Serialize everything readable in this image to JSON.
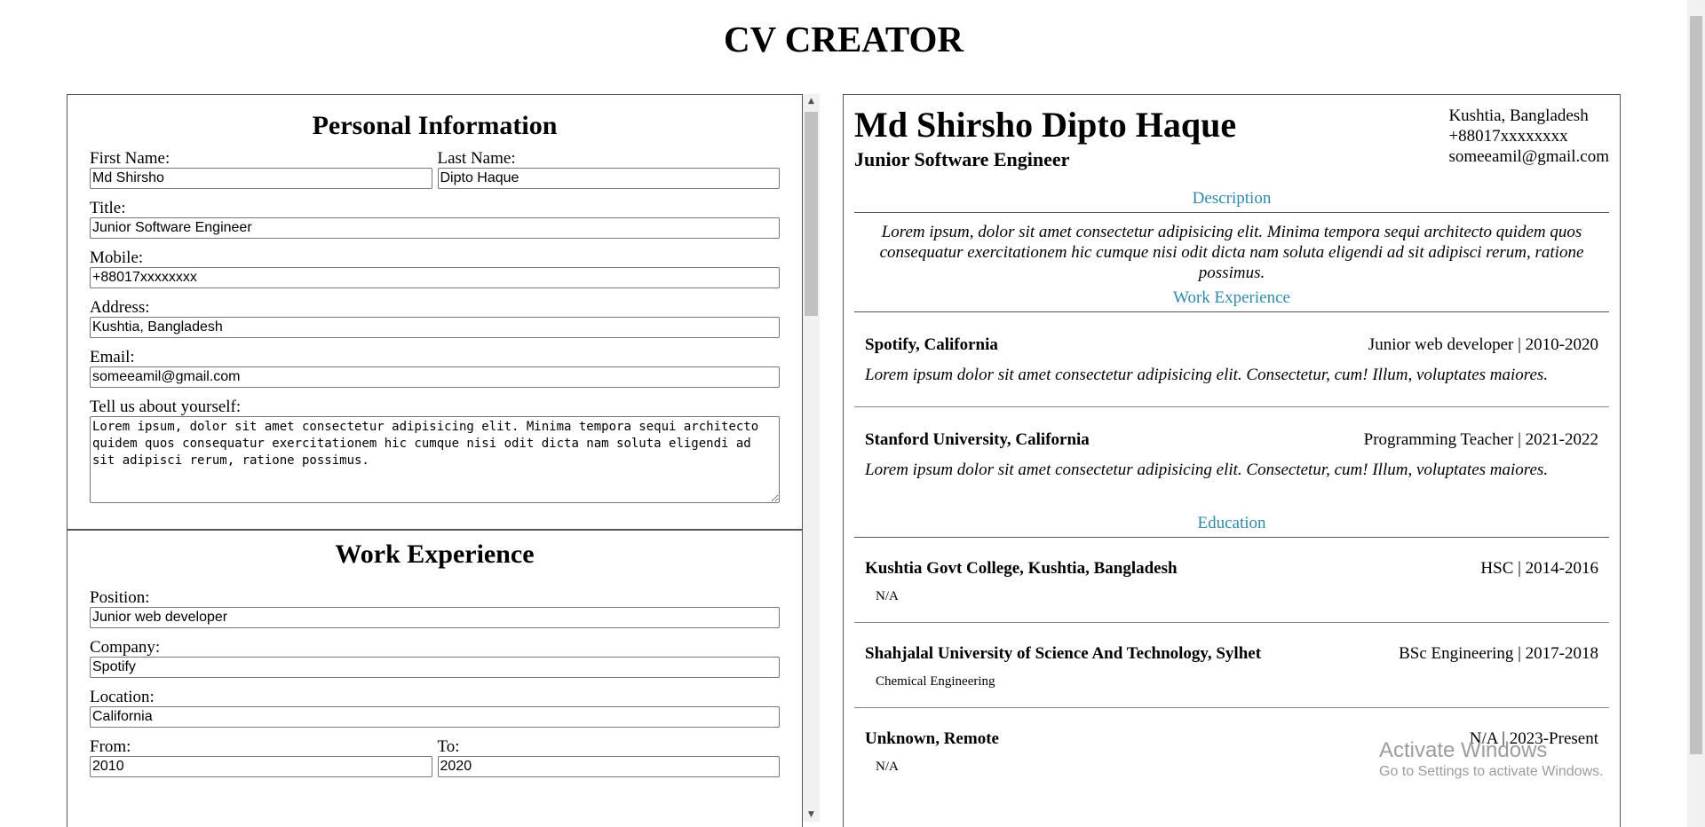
{
  "app": {
    "title": "CV CREATOR"
  },
  "form": {
    "personal": {
      "heading": "Personal Information",
      "first_name_label": "First Name:",
      "first_name_value": "Md Shirsho",
      "last_name_label": "Last Name:",
      "last_name_value": "Dipto Haque",
      "title_label": "Title:",
      "title_value": "Junior Software Engineer",
      "mobile_label": "Mobile:",
      "mobile_value": "+88017xxxxxxxx",
      "address_label": "Address:",
      "address_value": "Kushtia, Bangladesh",
      "email_label": "Email:",
      "email_value": "someeamil@gmail.com",
      "about_label": "Tell us about yourself:",
      "about_value": "Lorem ipsum, dolor sit amet consectetur adipisicing elit. Minima tempora sequi architecto quidem quos consequatur exercitationem hic cumque nisi odit dicta nam soluta eligendi ad sit adipisci rerum, ratione possimus."
    },
    "work": {
      "heading": "Work Experience",
      "position_label": "Position:",
      "position_value": "Junior web developer",
      "company_label": "Company:",
      "company_value": "Spotify",
      "location_label": "Location:",
      "location_value": "California",
      "from_label": "From:",
      "from_value": "2010",
      "to_label": "To:",
      "to_value": "2020"
    }
  },
  "cv": {
    "name": "Md Shirsho Dipto Haque",
    "title": "Junior Software Engineer",
    "address": "Kushtia, Bangladesh",
    "mobile": "+88017xxxxxxxx",
    "email": "someeamil@gmail.com",
    "description_heading": "Description",
    "description": "Lorem ipsum, dolor sit amet consectetur adipisicing elit. Minima tempora sequi architecto quidem quos consequatur exercitationem hic cumque nisi odit dicta nam soluta eligendi ad sit adipisci rerum, ratione possimus.",
    "work_heading": "Work Experience",
    "work": [
      {
        "company": "Spotify, California",
        "role": "Junior web developer | 2010-2020",
        "desc": "Lorem ipsum dolor sit amet consectetur adipisicing elit. Consectetur, cum! Illum, voluptates maiores."
      },
      {
        "company": "Stanford University, California",
        "role": "Programming Teacher | 2021-2022",
        "desc": "Lorem ipsum dolor sit amet consectetur adipisicing elit. Consectetur, cum! Illum, voluptates maiores."
      }
    ],
    "education_heading": "Education",
    "education": [
      {
        "school": "Kushtia Govt College, Kushtia, Bangladesh",
        "degree": "HSC | 2014-2016",
        "subject": "N/A"
      },
      {
        "school": "Shahjalal University of Science And Technology, Sylhet",
        "degree": "BSc Engineering | 2017-2018",
        "subject": "Chemical Engineering"
      },
      {
        "school": "Unknown, Remote",
        "degree": "N/A | 2023-Present",
        "subject": "N/A"
      }
    ]
  },
  "watermark": {
    "line1": "Activate Windows",
    "line2": "Go to Settings to activate Windows."
  }
}
